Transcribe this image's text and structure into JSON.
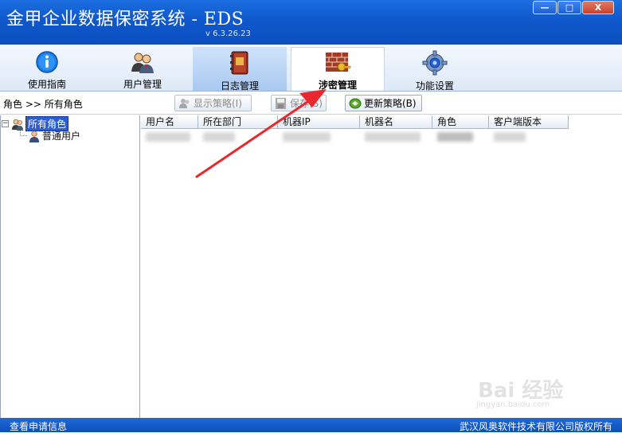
{
  "window": {
    "title": "金甲企业数据保密系统 - EDS",
    "version": "v 6.3.26.23",
    "controls": {
      "minimize": "—",
      "maximize": "□",
      "close": "X"
    }
  },
  "tabs": [
    {
      "label": "使用指南",
      "icon": "info-icon"
    },
    {
      "label": "用户管理",
      "icon": "users-icon"
    },
    {
      "label": "日志管理",
      "icon": "log-book-icon"
    },
    {
      "label": "涉密管理",
      "icon": "firewall-key-icon",
      "active": true
    },
    {
      "label": "功能设置",
      "icon": "gear-icon"
    }
  ],
  "toolbar": {
    "breadcrumb": "角色 >> 所有角色",
    "show_policy": "显示策略(I)",
    "save": "保存(S)",
    "update_policy": "更新策略(B)"
  },
  "tree": {
    "root": "所有角色",
    "children": [
      "普通用户"
    ]
  },
  "table": {
    "columns": [
      "用户名",
      "所在部门",
      "机器IP",
      "机器名",
      "角色",
      "客户端版本"
    ]
  },
  "status": {
    "left": "查看申请信息",
    "right": "武汉风奥软件技术有限公司版权所有"
  },
  "watermark": {
    "main": "Bai 经验",
    "sub": "jingyan.baidu.com"
  },
  "colors": {
    "titlebar": "#0f58cc",
    "selection": "#2b5fd1",
    "arrow": "#e8282c"
  }
}
